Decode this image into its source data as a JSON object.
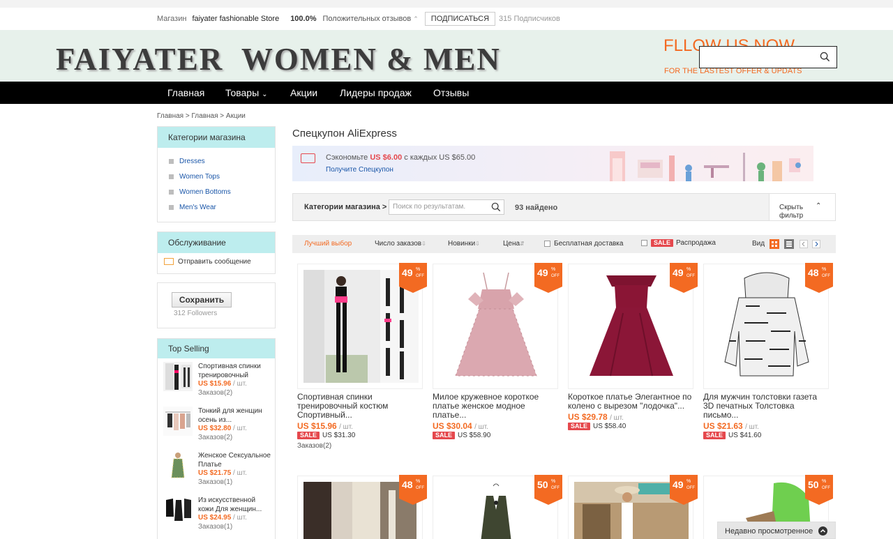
{
  "topbar": {
    "store_label": "Магазин",
    "store_name": "faiyater fashionable Store",
    "positive_pct": "100.0%",
    "positive_label": "Положительных отзывов",
    "subscribe_label": "ПОДПИСАТЬСЯ",
    "subscribers": "315 Подписчиков"
  },
  "banner": {
    "brand": "FAIYATER  WOMEN & MEN",
    "follow_title": "FLLOW US NOW",
    "follow_sub": "FOR THE LASTEST OFFER & UPDATS"
  },
  "nav": [
    "Главная",
    "Товары",
    "Акции",
    "Лидеры продаж",
    "Отзывы"
  ],
  "breadcrumb": "Главная > Главная > Акции",
  "sidebar": {
    "categories_title": "Категории магазина",
    "categories": [
      "Dresses",
      "Women Tops",
      "Women Bottoms",
      "Men's Wear"
    ],
    "service_title": "Обслуживание",
    "send_message": "Отправить сообщение",
    "save_label": "Сохранить",
    "followers": "312 Followers",
    "top_selling_title": "Top Selling",
    "top_selling": [
      {
        "title": "Спортивная спинки тренировочный",
        "price": "US $15.96",
        "unit": "/ шт.",
        "orders": "Заказов(2)"
      },
      {
        "title": "Тонкий для женщин осень из...",
        "price": "US $32.80",
        "unit": "/ шт.",
        "orders": "Заказов(2)"
      },
      {
        "title": "Женское Сексуальное Платье",
        "price": "US $21.75",
        "unit": "/ шт.",
        "orders": "Заказов(1)"
      },
      {
        "title": "Из искусственной кожи Для женщин...",
        "price": "US $24.95",
        "unit": "/ шт.",
        "orders": "Заказов(1)"
      }
    ]
  },
  "coupon": {
    "title": "Спецкупон AliExpress",
    "save_prefix": "Сэкономьте",
    "save_amount": "US $6.00",
    "save_suffix": "с каждых US $65.00",
    "get_label": "Получите Спецкупон"
  },
  "filter": {
    "label": "Категории магазина >",
    "placeholder": "Поиск по результатам.",
    "found": "93 найдено",
    "hide_label": "Скрыть фильтр"
  },
  "sort": {
    "best": "Лучший выбор",
    "orders": "Число заказов",
    "new": "Новинки",
    "price": "Цена",
    "free_shipping": "Бесплатная доставка",
    "sale_badge": "SALE",
    "sale_label": "Распродажа",
    "view_label": "Вид"
  },
  "products": [
    {
      "discount": "49",
      "off": "OFF",
      "name": "Спортивная спинки тренировочный костюм Спортивный...",
      "price": "US $15.96",
      "unit": "/ шт.",
      "sale": "SALE",
      "old": "US $31.30",
      "orders": "Заказов(2)"
    },
    {
      "discount": "49",
      "off": "OFF",
      "name": "Милое кружевное короткое платье женское модное платье...",
      "price": "US $30.04",
      "unit": "/ шт.",
      "sale": "SALE",
      "old": "US $58.90",
      "orders": ""
    },
    {
      "discount": "49",
      "off": "OFF",
      "name": "Короткое платье Элегантное по колено с вырезом \"лодочка\"...",
      "price": "US $29.78",
      "unit": "/ шт.",
      "sale": "SALE",
      "old": "US $58.40",
      "orders": ""
    },
    {
      "discount": "48",
      "off": "OFF",
      "name": "Для мужчин толстовки газета 3D печатных Толстовка письмо...",
      "price": "US $21.63",
      "unit": "/ шт.",
      "sale": "SALE",
      "old": "US $41.60",
      "orders": ""
    },
    {
      "discount": "48",
      "off": "OFF"
    },
    {
      "discount": "50",
      "off": "OFF"
    },
    {
      "discount": "49",
      "off": "OFF"
    },
    {
      "discount": "50",
      "off": "OFF"
    }
  ],
  "recent_label": "Недавно просмотренное",
  "colors": {
    "accent": "#f36a22",
    "sale": "#e5484d",
    "sidebar_head": "#bdedee",
    "nav": "#000000"
  }
}
